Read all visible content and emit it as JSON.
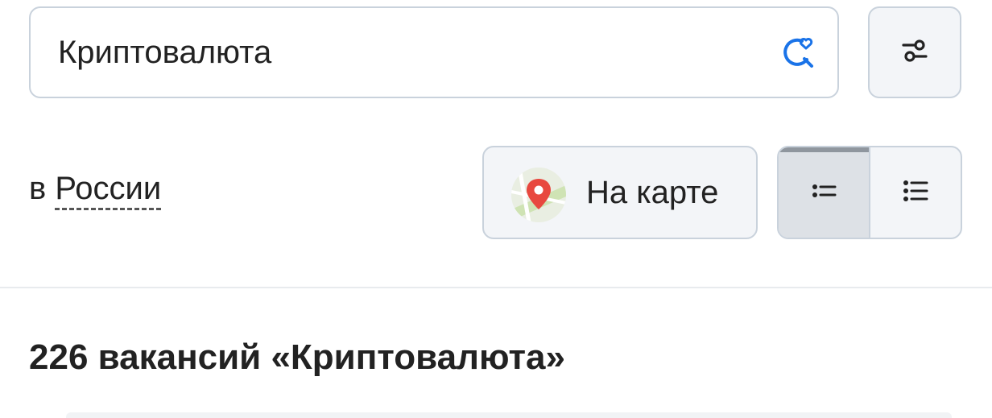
{
  "search": {
    "value": "Криптовалюта",
    "icon": "saved-search-heart-icon"
  },
  "filters": {
    "icon": "sliders-icon"
  },
  "region": {
    "prefix": "в ",
    "name": "России"
  },
  "map_button": {
    "label": "На карте",
    "icon": "map-pin-icon"
  },
  "view_toggle": {
    "options": [
      {
        "name": "compact-list",
        "icon": "compact-list-icon",
        "active": true
      },
      {
        "name": "detailed-list",
        "icon": "detailed-list-icon",
        "active": false
      }
    ]
  },
  "results": {
    "title": "226 вакансий «Криптовалюта»"
  },
  "colors": {
    "accent": "#1a73e8",
    "pin": "#e8483f",
    "text": "#222222",
    "border": "#c9d2dc"
  }
}
